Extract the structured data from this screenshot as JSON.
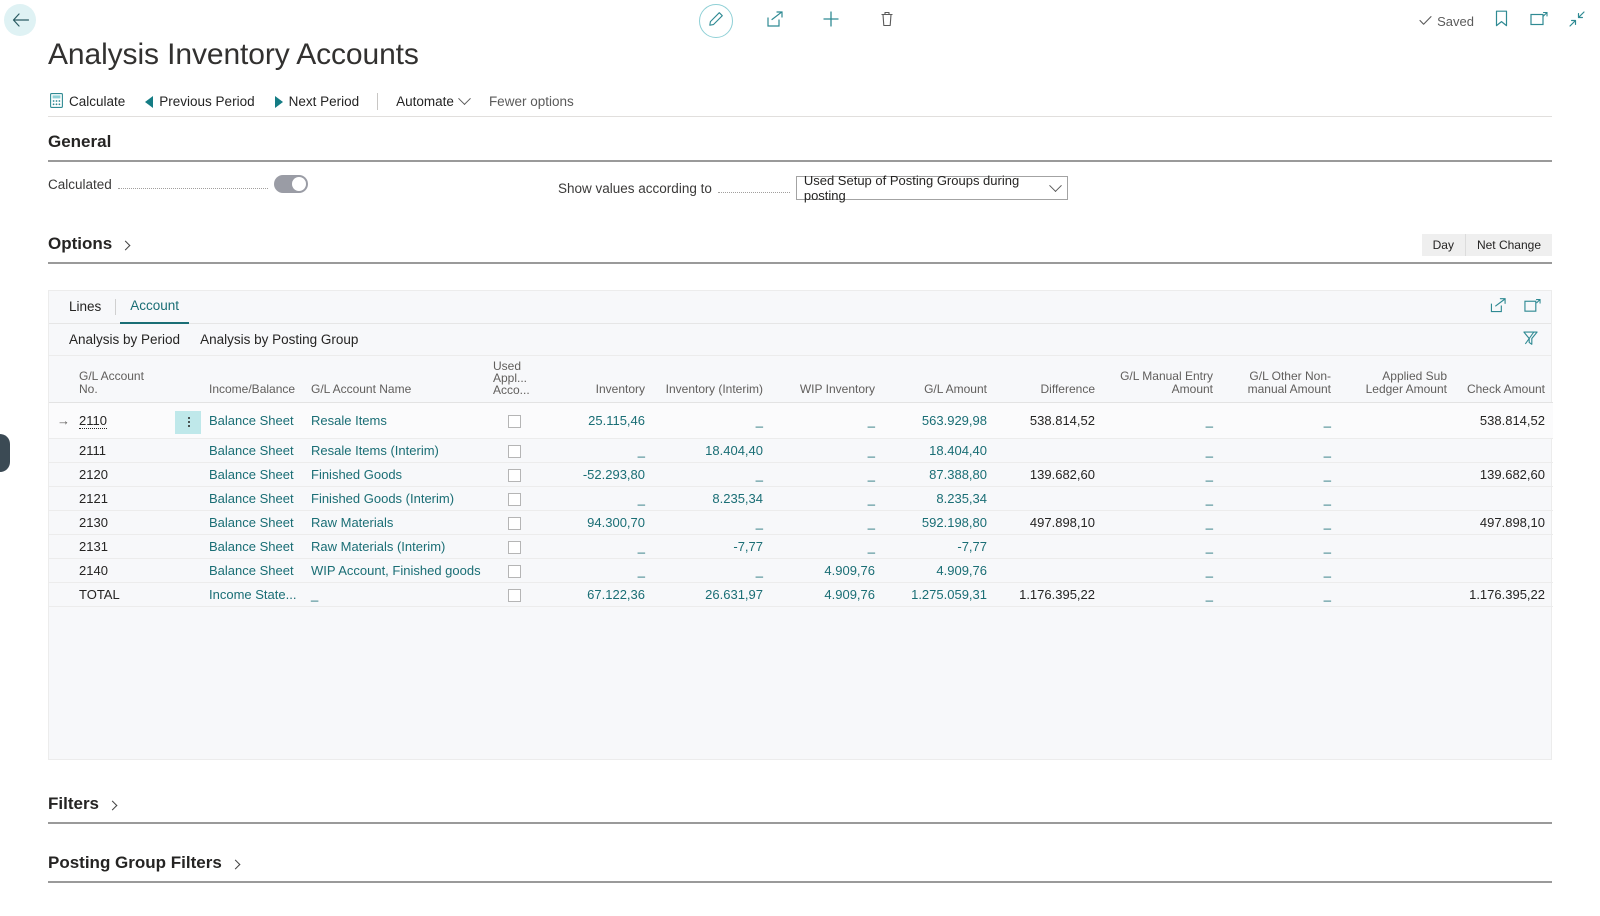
{
  "topbar": {
    "back_icon": "arrow-left-icon",
    "edit_icon": "pencil-icon",
    "share_icon": "share-icon",
    "new_icon": "plus-icon",
    "delete_icon": "trash-icon",
    "saved_label": "Saved",
    "bookmark_icon": "bookmark-icon",
    "openinnew_icon": "open-in-new-window-icon",
    "collapse_icon": "collapse-icon"
  },
  "page_title": "Analysis Inventory Accounts",
  "ribbon": {
    "calculate": "Calculate",
    "previous_period": "Previous Period",
    "next_period": "Next Period",
    "automate": "Automate",
    "fewer_options": "Fewer options"
  },
  "general": {
    "heading": "General",
    "calculated_label": "Calculated",
    "calculated_value": "on",
    "show_values_label": "Show values according to",
    "show_values_selected": "Used Setup of Posting Groups during posting"
  },
  "options": {
    "heading": "Options",
    "day_label": "Day",
    "net_change_label": "Net Change"
  },
  "panel": {
    "tabs": [
      {
        "label": "Lines",
        "active": false
      },
      {
        "label": "Account",
        "active": true
      }
    ],
    "tab_icons": [
      "share-icon",
      "open-in-excel-icon"
    ],
    "subtabs": [
      {
        "label": "Analysis by Period"
      },
      {
        "label": "Analysis by Posting Group"
      }
    ],
    "subtab_icon": "pin-filter-icon"
  },
  "table": {
    "columns": [
      {
        "key": "arrow",
        "label": "",
        "align": "left"
      },
      {
        "key": "account_no",
        "label": "G/L Account No.",
        "align": "left"
      },
      {
        "key": "menu",
        "label": "",
        "align": "left"
      },
      {
        "key": "income_balance",
        "label": "Income/Balance",
        "align": "left"
      },
      {
        "key": "account_name",
        "label": "G/L Account Name",
        "align": "left"
      },
      {
        "key": "used_appl",
        "label": "Used Appl... Acco...",
        "align": "left"
      },
      {
        "key": "inventory",
        "label": "Inventory",
        "align": "right"
      },
      {
        "key": "inventory_interim",
        "label": "Inventory (Interim)",
        "align": "right"
      },
      {
        "key": "wip_inventory",
        "label": "WIP Inventory",
        "align": "right"
      },
      {
        "key": "gl_amount",
        "label": "G/L Amount",
        "align": "right"
      },
      {
        "key": "difference",
        "label": "Difference",
        "align": "right"
      },
      {
        "key": "gl_manual_entry_amount",
        "label": "G/L Manual Entry Amount",
        "align": "right"
      },
      {
        "key": "gl_other_nonmanual_amount",
        "label": "G/L Other Non-manual Amount",
        "align": "right"
      },
      {
        "key": "applied_sub_ledger_amount",
        "label": "Applied Sub Ledger Amount",
        "align": "right"
      },
      {
        "key": "check_amount",
        "label": "Check Amount",
        "align": "right"
      }
    ],
    "rows": [
      {
        "selected": true,
        "account_no": "2110",
        "income_balance": "Balance Sheet",
        "account_name": "Resale Items",
        "used_appl": false,
        "inventory": "25.115,46",
        "inventory_interim": "_",
        "wip_inventory": "_",
        "gl_amount": "563.929,98",
        "difference": "538.814,52",
        "gl_manual_entry_amount": "_",
        "gl_other_nonmanual_amount": "_",
        "applied_sub_ledger_amount": "",
        "check_amount": "538.814,52"
      },
      {
        "selected": false,
        "account_no": "2111",
        "income_balance": "Balance Sheet",
        "account_name": "Resale Items (Interim)",
        "used_appl": false,
        "inventory": "_",
        "inventory_interim": "18.404,40",
        "wip_inventory": "_",
        "gl_amount": "18.404,40",
        "difference": "",
        "gl_manual_entry_amount": "_",
        "gl_other_nonmanual_amount": "_",
        "applied_sub_ledger_amount": "",
        "check_amount": ""
      },
      {
        "selected": false,
        "account_no": "2120",
        "income_balance": "Balance Sheet",
        "account_name": "Finished Goods",
        "used_appl": false,
        "inventory": "-52.293,80",
        "inventory_interim": "_",
        "wip_inventory": "_",
        "gl_amount": "87.388,80",
        "difference": "139.682,60",
        "gl_manual_entry_amount": "_",
        "gl_other_nonmanual_amount": "_",
        "applied_sub_ledger_amount": "",
        "check_amount": "139.682,60"
      },
      {
        "selected": false,
        "account_no": "2121",
        "income_balance": "Balance Sheet",
        "account_name": "Finished Goods (Interim)",
        "used_appl": false,
        "inventory": "_",
        "inventory_interim": "8.235,34",
        "wip_inventory": "_",
        "gl_amount": "8.235,34",
        "difference": "",
        "gl_manual_entry_amount": "_",
        "gl_other_nonmanual_amount": "_",
        "applied_sub_ledger_amount": "",
        "check_amount": ""
      },
      {
        "selected": false,
        "account_no": "2130",
        "income_balance": "Balance Sheet",
        "account_name": "Raw Materials",
        "used_appl": false,
        "inventory": "94.300,70",
        "inventory_interim": "_",
        "wip_inventory": "_",
        "gl_amount": "592.198,80",
        "difference": "497.898,10",
        "gl_manual_entry_amount": "_",
        "gl_other_nonmanual_amount": "_",
        "applied_sub_ledger_amount": "",
        "check_amount": "497.898,10"
      },
      {
        "selected": false,
        "account_no": "2131",
        "income_balance": "Balance Sheet",
        "account_name": "Raw Materials (Interim)",
        "used_appl": false,
        "inventory": "_",
        "inventory_interim": "-7,77",
        "wip_inventory": "_",
        "gl_amount": "-7,77",
        "difference": "",
        "gl_manual_entry_amount": "_",
        "gl_other_nonmanual_amount": "_",
        "applied_sub_ledger_amount": "",
        "check_amount": ""
      },
      {
        "selected": false,
        "account_no": "2140",
        "income_balance": "Balance Sheet",
        "account_name": "WIP Account, Finished goods",
        "used_appl": false,
        "inventory": "_",
        "inventory_interim": "_",
        "wip_inventory": "4.909,76",
        "gl_amount": "4.909,76",
        "difference": "",
        "gl_manual_entry_amount": "_",
        "gl_other_nonmanual_amount": "_",
        "applied_sub_ledger_amount": "",
        "check_amount": ""
      },
      {
        "selected": false,
        "is_total": true,
        "account_no": "TOTAL",
        "income_balance": "Income State...",
        "account_name": "_",
        "used_appl": false,
        "inventory": "67.122,36",
        "inventory_interim": "26.631,97",
        "wip_inventory": "4.909,76",
        "gl_amount": "1.275.059,31",
        "difference": "1.176.395,22",
        "gl_manual_entry_amount": "_",
        "gl_other_nonmanual_amount": "_",
        "applied_sub_ledger_amount": "",
        "check_amount": "1.176.395,22"
      }
    ]
  },
  "filters": {
    "heading": "Filters"
  },
  "posting_group_filters": {
    "heading": "Posting Group Filters"
  },
  "colors": {
    "accent": "#1a6e75",
    "link": "#1a6e75",
    "text": "#252423",
    "panel_bg": "#f7f8fa",
    "selected_cell": "#bfe8ea"
  }
}
